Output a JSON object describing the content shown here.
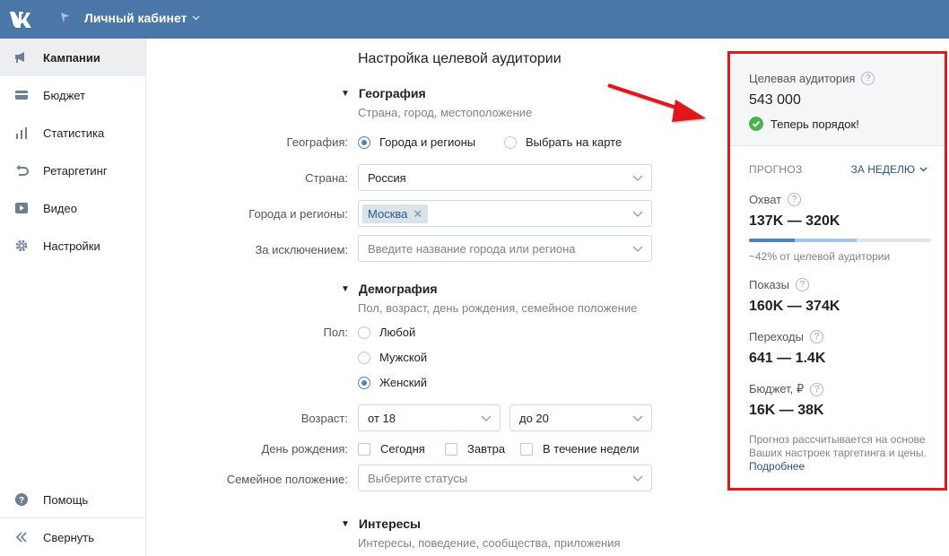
{
  "header": {
    "title": "Личный кабинет",
    "bg_color": "#4a76a8"
  },
  "sidebar": {
    "items": [
      {
        "label": "Кампании",
        "icon": "megaphone-icon",
        "active": true
      },
      {
        "label": "Бюджет",
        "icon": "wallet-icon"
      },
      {
        "label": "Статистика",
        "icon": "stats-icon"
      },
      {
        "label": "Ретаргетинг",
        "icon": "retarget-icon"
      },
      {
        "label": "Видео",
        "icon": "video-icon"
      },
      {
        "label": "Настройки",
        "icon": "gear-icon"
      }
    ],
    "help": "Помощь",
    "collapse": "Свернуть"
  },
  "main": {
    "title": "Настройка целевой аудитории",
    "geo": {
      "heading": "География",
      "subtitle": "Страна, город, местоположение",
      "label_geo": "География:",
      "opt_cities": "Города и регионы",
      "opt_map": "Выбрать на карте",
      "label_country": "Страна:",
      "country_value": "Россия",
      "label_cities": "Города и регионы:",
      "city_tag": "Москва",
      "label_except": "За исключением:",
      "except_placeholder": "Введите название города или региона"
    },
    "demo": {
      "heading": "Демография",
      "subtitle": "Пол, возраст, день рождения, семейное положение",
      "label_sex": "Пол:",
      "sex_any": "Любой",
      "sex_male": "Мужской",
      "sex_female": "Женский",
      "label_age": "Возраст:",
      "age_from": "от 18",
      "age_to": "до 20",
      "label_bday": "День рождения:",
      "bday_today": "Сегодня",
      "bday_tomorrow": "Завтра",
      "bday_week": "В течение недели",
      "label_family": "Семейное положение:",
      "family_placeholder": "Выберите статусы"
    },
    "interests": {
      "heading": "Интересы",
      "subtitle": "Интересы, поведение, сообщества, приложения"
    }
  },
  "panel": {
    "audience_label": "Целевая аудитория",
    "audience_value": "543 000",
    "status": "Теперь порядок!",
    "forecast_label": "ПРОГНОЗ",
    "period": "ЗА НЕДЕЛЮ",
    "reach_label": "Охват",
    "reach_value": "137K — 320K",
    "reach_bar_fraction": 0.25,
    "reach_bar_light_fraction": 0.59,
    "reach_note": "~42% от целевой аудитории",
    "impressions_label": "Показы",
    "impressions_value": "160K — 374K",
    "clicks_label": "Переходы",
    "clicks_value": "641 — 1.4K",
    "budget_label": "Бюджет, ₽",
    "budget_value": "16K — 38K",
    "note": "Прогноз рассчитывается на основе Ваших настроек таргетинга и цены.",
    "note_link": "Подробнее",
    "border_color": "#e0181f"
  }
}
